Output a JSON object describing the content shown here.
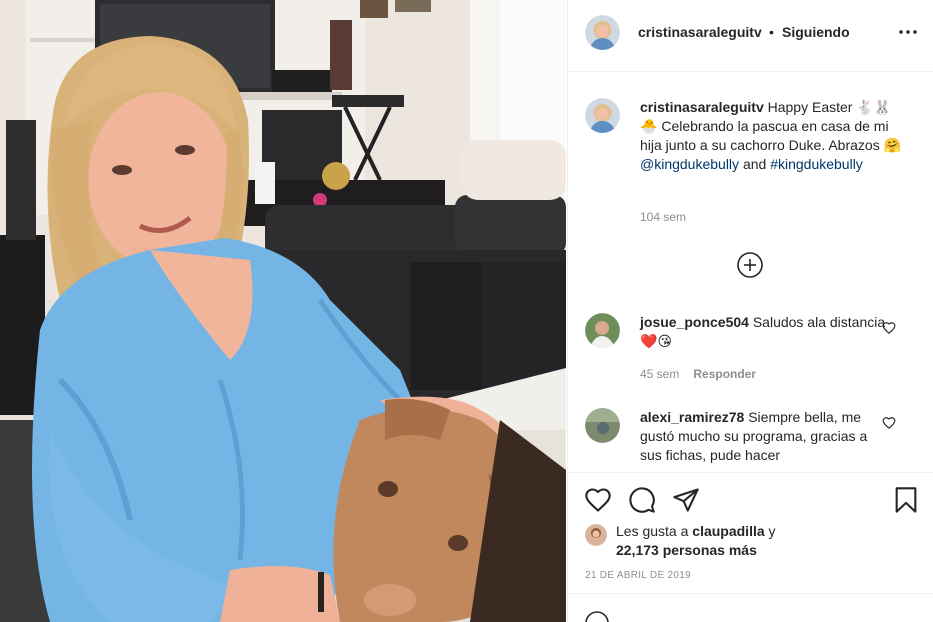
{
  "post": {
    "username": "cristinasaraleguitv",
    "separator": "•",
    "follow_status": "Siguiendo",
    "more_icon": "more-horizontal-icon"
  },
  "caption": {
    "username": "cristinasaraleguitv",
    "part1": "Happy Easter",
    "emoji1": "🐇",
    "emoji2": "🐰",
    "emoji3": "🐣",
    "part2": "Celebrando la pascua en casa de mi hija junto a su cachorro Duke. Abrazos",
    "emoji4": "🤗",
    "mention": "@kingdukebully",
    "and_text": "and",
    "hashtag": "#kingdukebully",
    "time": "104 sem"
  },
  "load_more_icon": "plus-circle-icon",
  "comments": [
    {
      "username": "josue_ponce504",
      "text": "Saludos ala distancia",
      "emojis": "❤️😘",
      "time": "45 sem",
      "reply": "Responder"
    },
    {
      "username": "alexi_ramirez78",
      "text": "Siempre bella, me gustó mucho su programa, gracias a sus fichas, pude hacer"
    }
  ],
  "actions": {
    "like_icon": "heart-icon",
    "comment_icon": "comment-icon",
    "share_icon": "send-icon",
    "save_icon": "bookmark-icon"
  },
  "likes": {
    "prefix": "Les gusta a",
    "user": "claupadilla",
    "conj": "y",
    "count": "22,173 personas más"
  },
  "date": "21 DE ABRIL DE 2019",
  "colors": {
    "link": "#00376b",
    "meta": "#8e8e8e",
    "heart": "#ed4956",
    "border": "#efefef"
  }
}
